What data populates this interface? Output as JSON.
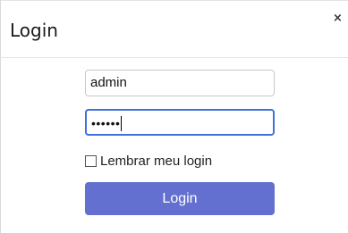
{
  "dialog": {
    "title": "Login",
    "close_glyph": "×"
  },
  "form": {
    "username_value": "admin",
    "password_masked": "••••••",
    "remember_label": "Lembrar meu login",
    "remember_checked": false,
    "submit_label": "Login"
  },
  "colors": {
    "button_bg": "#6470cf",
    "focus_border": "#3f71d9"
  }
}
